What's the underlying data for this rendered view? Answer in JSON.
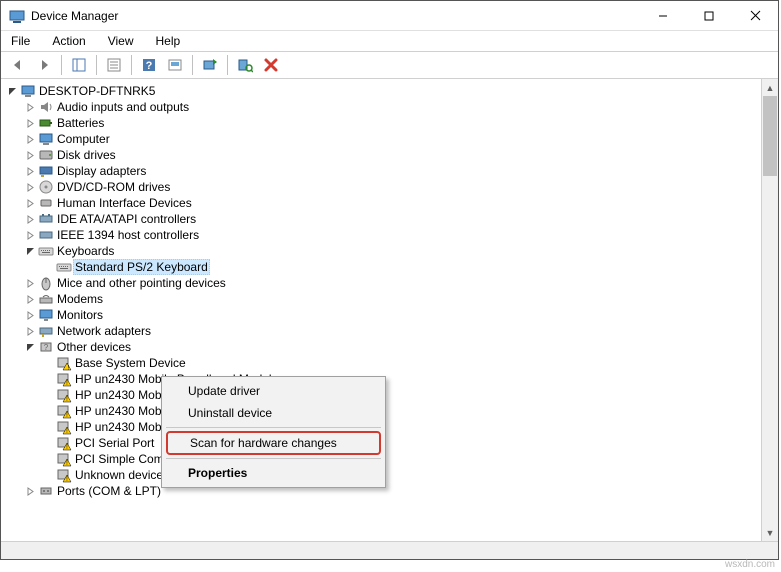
{
  "window": {
    "title": "Device Manager"
  },
  "menubar": {
    "file": "File",
    "action": "Action",
    "view": "View",
    "help": "Help"
  },
  "toolbar_icons": {
    "back": "back-arrow-icon",
    "forward": "forward-arrow-icon",
    "show_hide": "show-hide-console-icon",
    "help_topics": "help-icon",
    "properties": "properties-icon",
    "update": "update-driver-icon",
    "scan": "scan-hardware-icon",
    "uninstall": "uninstall-icon",
    "red_x": "remove-icon"
  },
  "tree": {
    "root": "DESKTOP-DFTNRK5",
    "categories": {
      "audio": "Audio inputs and outputs",
      "batteries": "Batteries",
      "computer": "Computer",
      "disk": "Disk drives",
      "display": "Display adapters",
      "dvd": "DVD/CD-ROM drives",
      "hid": "Human Interface Devices",
      "ide": "IDE ATA/ATAPI controllers",
      "ieee": "IEEE 1394 host controllers",
      "keyboards": "Keyboards",
      "mice": "Mice and other pointing devices",
      "modems": "Modems",
      "monitors": "Monitors",
      "network": "Network adapters",
      "other": "Other devices",
      "ports": "Ports (COM & LPT)"
    },
    "keyboard_child": "Standard PS/2 Keyboard",
    "other_children": {
      "bsd": "Base System Device",
      "hp1": "HP un2430 Mobile Broadband Module",
      "hp2": "HP un2430 Mobile Broadband Module",
      "hp3": "HP un2430 Mobile Broadband Module",
      "hp4": "HP un2430 Mobile Broadband Module",
      "pciserial": "PCI Serial Port",
      "pcisimple": "PCI Simple Communications Controller",
      "unknown": "Unknown device"
    }
  },
  "contextmenu": {
    "update": "Update driver",
    "uninstall": "Uninstall device",
    "scan": "Scan for hardware changes",
    "properties": "Properties"
  },
  "watermark": "wsxdn.com",
  "colors": {
    "highlight_border": "#d23a2f",
    "selection_bg": "#cce8ff"
  }
}
